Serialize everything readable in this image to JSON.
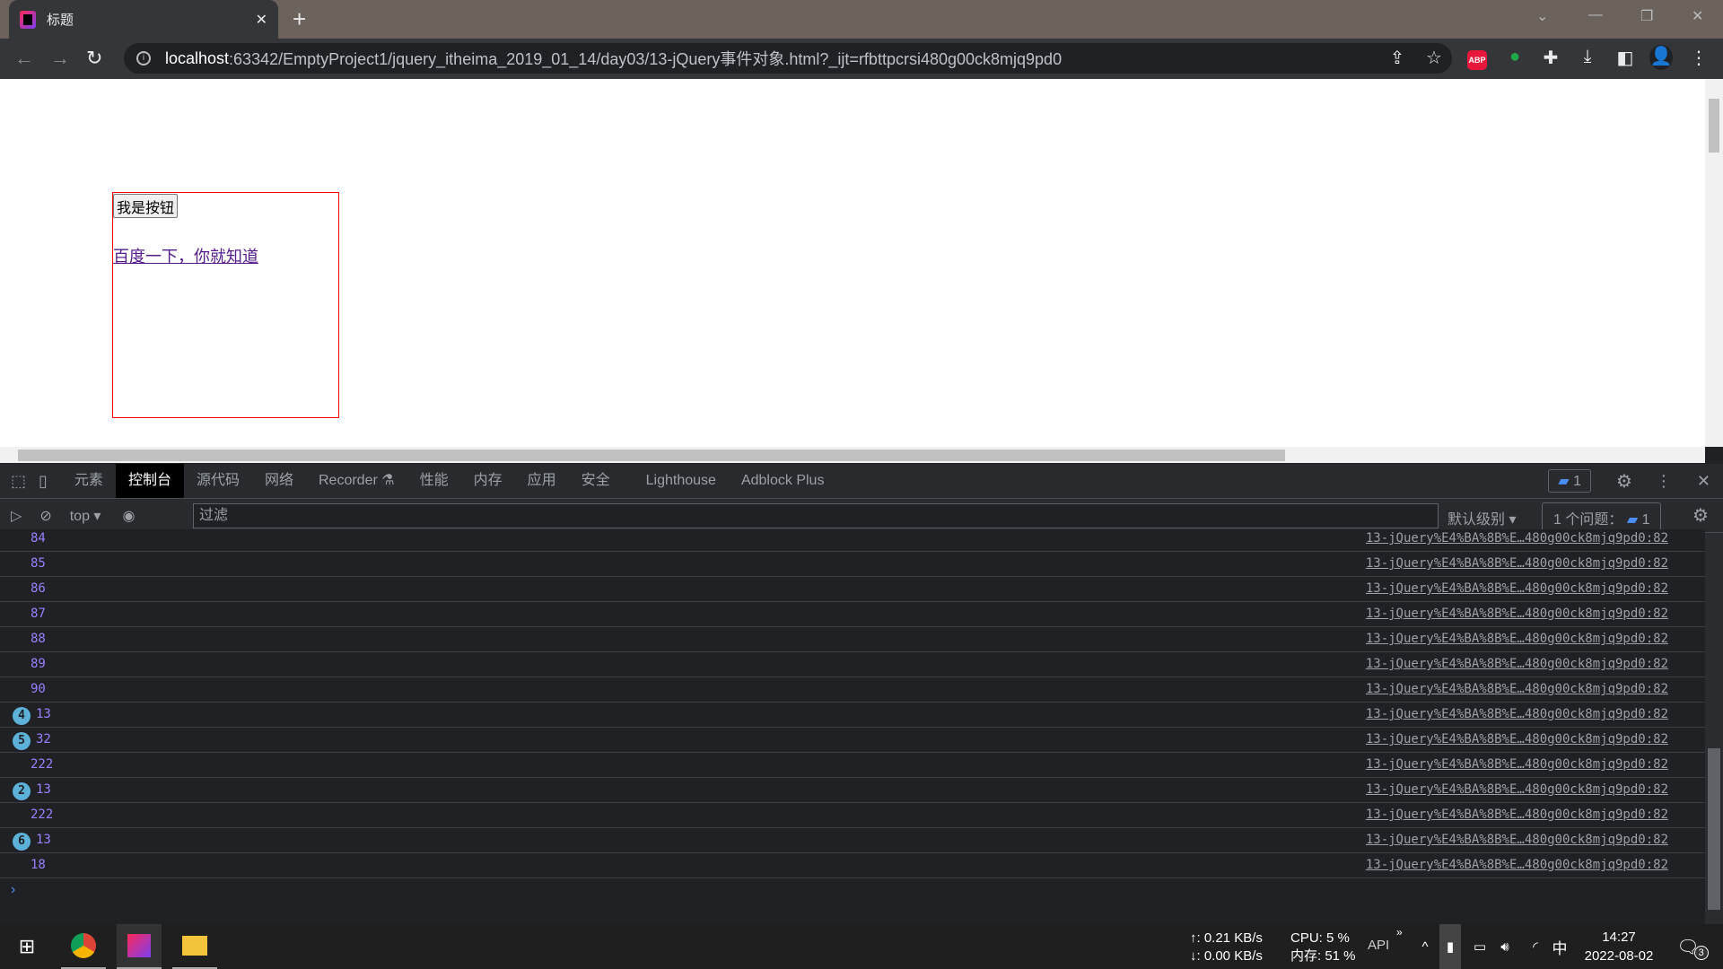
{
  "browser": {
    "tab_title": "标题",
    "url_host": "localhost",
    "url_rest": ":63342/EmptyProject1/jquery_itheima_2019_01_14/day03/13-jQuery事件对象.html?_ijt=rfbttpcrsi480g00ck8mjq9pd0"
  },
  "page": {
    "button_label": "我是按钮",
    "link_text": "百度一下，你就知道",
    "box_border_color": "#ff0000"
  },
  "devtools": {
    "tabs": [
      "元素",
      "控制台",
      "源代码",
      "网络",
      "Recorder",
      "性能",
      "内存",
      "应用",
      "安全",
      "Lighthouse",
      "Adblock Plus"
    ],
    "active_tab": "控制台",
    "issues_badge": "1",
    "context": "top",
    "filter_placeholder": "过滤",
    "level": "默认级别",
    "issues_label": "1 个问题：",
    "issues_count": "1",
    "rows": [
      {
        "value": "84",
        "count": null,
        "source": "13-jQuery%E4%BA%8B%E…480g00ck8mjq9pd0:82"
      },
      {
        "value": "85",
        "count": null,
        "source": "13-jQuery%E4%BA%8B%E…480g00ck8mjq9pd0:82"
      },
      {
        "value": "86",
        "count": null,
        "source": "13-jQuery%E4%BA%8B%E…480g00ck8mjq9pd0:82"
      },
      {
        "value": "87",
        "count": null,
        "source": "13-jQuery%E4%BA%8B%E…480g00ck8mjq9pd0:82"
      },
      {
        "value": "88",
        "count": null,
        "source": "13-jQuery%E4%BA%8B%E…480g00ck8mjq9pd0:82"
      },
      {
        "value": "89",
        "count": null,
        "source": "13-jQuery%E4%BA%8B%E…480g00ck8mjq9pd0:82"
      },
      {
        "value": "90",
        "count": null,
        "source": "13-jQuery%E4%BA%8B%E…480g00ck8mjq9pd0:82"
      },
      {
        "value": "13",
        "count": "4",
        "source": "13-jQuery%E4%BA%8B%E…480g00ck8mjq9pd0:82"
      },
      {
        "value": "32",
        "count": "5",
        "source": "13-jQuery%E4%BA%8B%E…480g00ck8mjq9pd0:82"
      },
      {
        "value": "222",
        "count": null,
        "source": "13-jQuery%E4%BA%8B%E…480g00ck8mjq9pd0:82"
      },
      {
        "value": "13",
        "count": "2",
        "source": "13-jQuery%E4%BA%8B%E…480g00ck8mjq9pd0:82"
      },
      {
        "value": "222",
        "count": null,
        "source": "13-jQuery%E4%BA%8B%E…480g00ck8mjq9pd0:82"
      },
      {
        "value": "13",
        "count": "6",
        "source": "13-jQuery%E4%BA%8B%E…480g00ck8mjq9pd0:82"
      },
      {
        "value": "18",
        "count": null,
        "source": "13-jQuery%E4%BA%8B%E…480g00ck8mjq9pd0:82"
      }
    ]
  },
  "taskbar": {
    "upload": "↑: 0.21 KB/s",
    "download": "↓: 0.00 KB/s",
    "cpu": "CPU: 5 %",
    "memory": "内存: 51 %",
    "api": "API",
    "ime": "中",
    "time": "14:27",
    "date": "2022-08-02",
    "notifications": "3"
  }
}
